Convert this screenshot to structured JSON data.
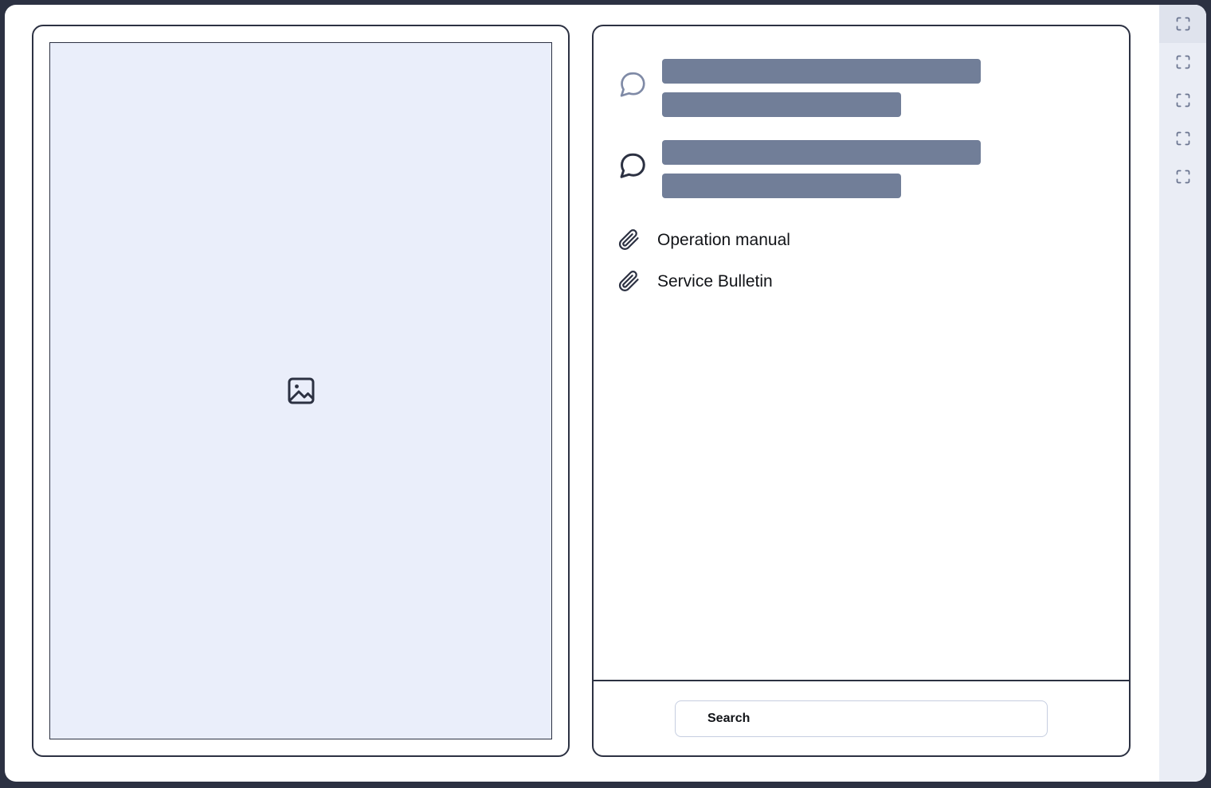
{
  "colors": {
    "frame": "#2c3142",
    "page_bg": "#ffffff",
    "image_placeholder_bg": "#eaeefa",
    "skeleton": "#717e98",
    "strip_bg": "#eaedf5",
    "strip_active_bg": "#dfe3ed",
    "strip_icon": "#6b7590",
    "text": "#111317",
    "input_border": "#c6cee0",
    "icon_muted": "#7f8aa6",
    "icon_dark": "#2c3142"
  },
  "viewer": {
    "image_icon": "image-placeholder-icon"
  },
  "details": {
    "comments": [
      {
        "icon": "chat-bubble-icon",
        "icon_state": "muted",
        "lines": [
          {
            "width": "long"
          },
          {
            "width": "short"
          }
        ]
      },
      {
        "icon": "chat-bubble-icon",
        "icon_state": "dark",
        "lines": [
          {
            "width": "long"
          },
          {
            "width": "short"
          }
        ]
      }
    ],
    "attachments": [
      {
        "icon": "paperclip-icon",
        "label": "Operation manual"
      },
      {
        "icon": "paperclip-icon",
        "label": "Service Bulletin"
      }
    ]
  },
  "search": {
    "value": "Search",
    "placeholder": "Search"
  },
  "tool_strip": {
    "items": [
      {
        "icon": "fullscreen-icon",
        "active": true
      },
      {
        "icon": "fullscreen-icon",
        "active": false
      },
      {
        "icon": "fullscreen-icon",
        "active": false
      },
      {
        "icon": "fullscreen-icon",
        "active": false
      },
      {
        "icon": "fullscreen-icon",
        "active": false
      }
    ]
  }
}
